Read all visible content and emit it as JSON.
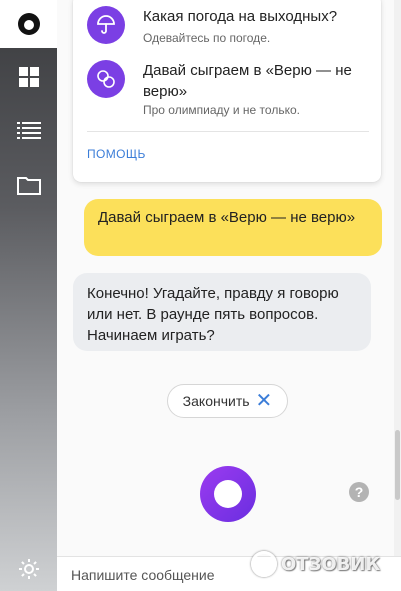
{
  "sidebar": {
    "icons": [
      "alice-logo-icon",
      "grid-icon",
      "list-icon",
      "folder-icon",
      "gear-icon"
    ]
  },
  "card": {
    "items": [
      {
        "title": "Какая погода на выходных?",
        "subtitle": "Одевайтесь по погоде.",
        "icon": "umbrella-icon"
      },
      {
        "title": "Давай сыграем в «Верю — не верю»",
        "subtitle": "Про олимпиаду и не только.",
        "icon": "medals-icon"
      }
    ],
    "help_label": "ПОМОЩЬ"
  },
  "chat": {
    "user_message": "Давай сыграем в «Верю — не верю»",
    "bot_message": "Конечно! Угадайте, правду я говорю или нет. В раунде пять вопросов. Начинаем играть?",
    "finish_label": "Закончить"
  },
  "input": {
    "placeholder": "Напишите сообщение"
  },
  "watermark": {
    "text": "ОТЗОВИК"
  },
  "colors": {
    "accent": "#7b3fe4",
    "user_bubble": "#fce05a",
    "bot_bubble": "#ebedf0",
    "link": "#3b7dd8"
  }
}
